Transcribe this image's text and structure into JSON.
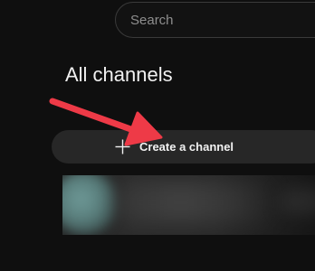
{
  "search": {
    "placeholder": "Search",
    "value": ""
  },
  "page": {
    "title": "All channels"
  },
  "create_channel": {
    "label": "Create a channel",
    "icon": "plus-icon"
  },
  "annotation": {
    "color": "#ee3a47",
    "icon": "arrow-pointer"
  },
  "colors": {
    "background": "#0f0f0f",
    "button_bg": "#272727",
    "text": "#f1f1f1"
  }
}
